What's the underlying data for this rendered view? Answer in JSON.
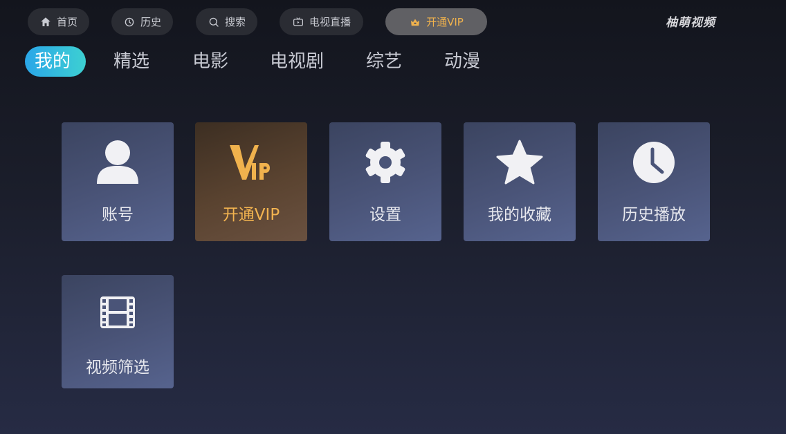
{
  "topbar": {
    "items": [
      {
        "label": "首页",
        "icon": "home-icon"
      },
      {
        "label": "历史",
        "icon": "clock-icon"
      },
      {
        "label": "搜索",
        "icon": "search-icon"
      },
      {
        "label": "电视直播",
        "icon": "tv-icon"
      },
      {
        "label": "开通VIP",
        "icon": "crown-icon"
      }
    ]
  },
  "brand": "柚萌视频",
  "tabs": [
    "我的",
    "精选",
    "电影",
    "电视剧",
    "综艺",
    "动漫"
  ],
  "tiles": [
    {
      "label": "账号",
      "icon": "user-icon"
    },
    {
      "label": "开通VIP",
      "icon": "vip-logo-icon"
    },
    {
      "label": "设置",
      "icon": "gear-icon"
    },
    {
      "label": "我的收藏",
      "icon": "star-icon"
    },
    {
      "label": "历史播放",
      "icon": "clock-icon"
    },
    {
      "label": "视频筛选",
      "icon": "film-icon"
    }
  ],
  "colors": {
    "accent": "#2aa6e8",
    "vip": "#f0b24d"
  }
}
